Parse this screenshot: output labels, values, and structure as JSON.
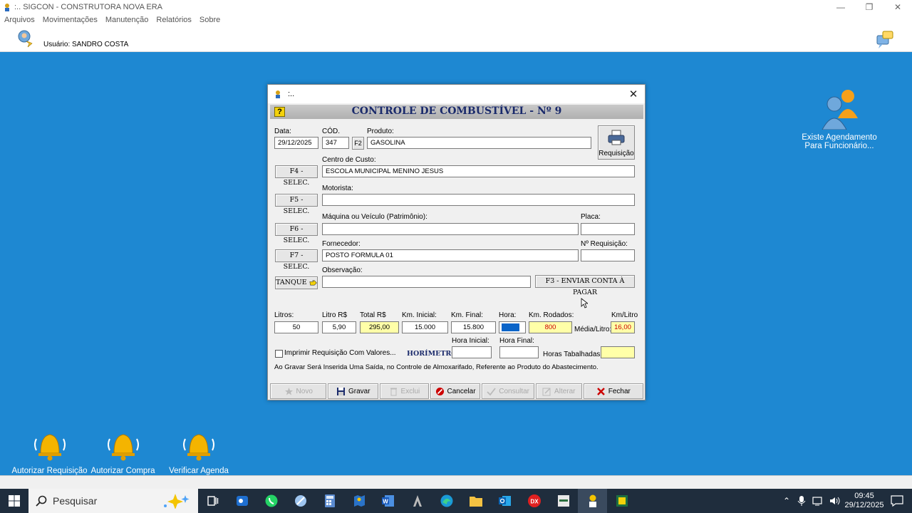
{
  "app": {
    "window_title": ":.. SIGCON - CONSTRUTORA NOVA ERA",
    "menu": [
      "Arquivos",
      "Movimentações",
      "Manutenção",
      "Relatórios",
      "Sobre"
    ],
    "user_label": "Usuário: SANDRO COSTA"
  },
  "desktop": {
    "shortcuts": [
      {
        "label": "Autorizar Requisição"
      },
      {
        "label": "Autorizar Compra"
      },
      {
        "label": "Verificar Agenda"
      }
    ],
    "agenda_notice": "Existe Agendamento Para Funcionário..."
  },
  "dialog": {
    "title": ":..",
    "header": "CONTROLE DE COMBUSTÍVEL - Nº 9",
    "help_glyph": "?",
    "labels": {
      "data": "Data:",
      "cod": "CÓD.",
      "produto": "Produto:",
      "centro_custo": "Centro de Custo:",
      "motorista": "Motorista:",
      "maquina": "Máquina ou Veículo (Patrimônio):",
      "placa": "Placa:",
      "fornecedor": "Fornecedor:",
      "nr_requisicao": "Nº Requisição:",
      "observacao": "Observação:",
      "litros": "Litros:",
      "litro_rs": "Litro R$",
      "total_rs": "Total R$",
      "km_inicial": "Km. Inicial:",
      "km_final": "Km. Final:",
      "hora": "Hora:",
      "km_rodados": "Km. Rodados:",
      "km_litro": "Km/Litro",
      "media_litro": "Média/Litro:",
      "hora_inicial": "Hora Inicial:",
      "hora_final": "Hora Final:",
      "horas_tabalhadas": "Horas Tabalhadas:",
      "horimetro": "HORÍMETRO:",
      "imprimir": "Imprimir Requisição Com Valores...",
      "info": "Ao Gravar Será Inserida Uma Saída, no Controle de Almoxarifado, Referente ao Produto do Abastecimento."
    },
    "values": {
      "data": "29/12/2025",
      "cod": "347",
      "produto": "GASOLINA",
      "centro_custo": "ESCOLA MUNICIPAL MENINO JESUS",
      "motorista": "",
      "maquina": "",
      "placa": "",
      "fornecedor": "POSTO FORMULA 01",
      "nr_requisicao": "",
      "observacao": "",
      "litros": "50",
      "litro_rs": "5,90",
      "total_rs": "295,00",
      "km_inicial": "15.000",
      "km_final": "15.800",
      "hora": "",
      "km_rodados": "800",
      "km_litro": "16,00",
      "hora_inicial": "",
      "hora_final": "",
      "horas_tabalhadas": ""
    },
    "buttons": {
      "f2": "F2",
      "f4": "F4 - SELEC.",
      "f5": "F5 - SELEC.",
      "f6": "F6 - SELEC.",
      "f7": "F7 - SELEC.",
      "tanque": "TANQUE",
      "f3": "F3 - ENVIAR CONTA À PAGAR",
      "requisicao": "Requisição",
      "novo": "Novo",
      "gravar": "Gravar",
      "exclui": "Exclui",
      "cancelar": "Cancelar",
      "consultar": "Consultar",
      "alterar": "Alterar",
      "fechar": "Fechar"
    }
  },
  "taskbar": {
    "search_placeholder": "Pesquisar",
    "time": "09:45",
    "date": "29/12/2025"
  },
  "colors": {
    "desktop": "#1e88d2",
    "banner_title": "#1a2a6b",
    "yellow_field": "#ffffa8",
    "red_value": "#cc0000"
  }
}
